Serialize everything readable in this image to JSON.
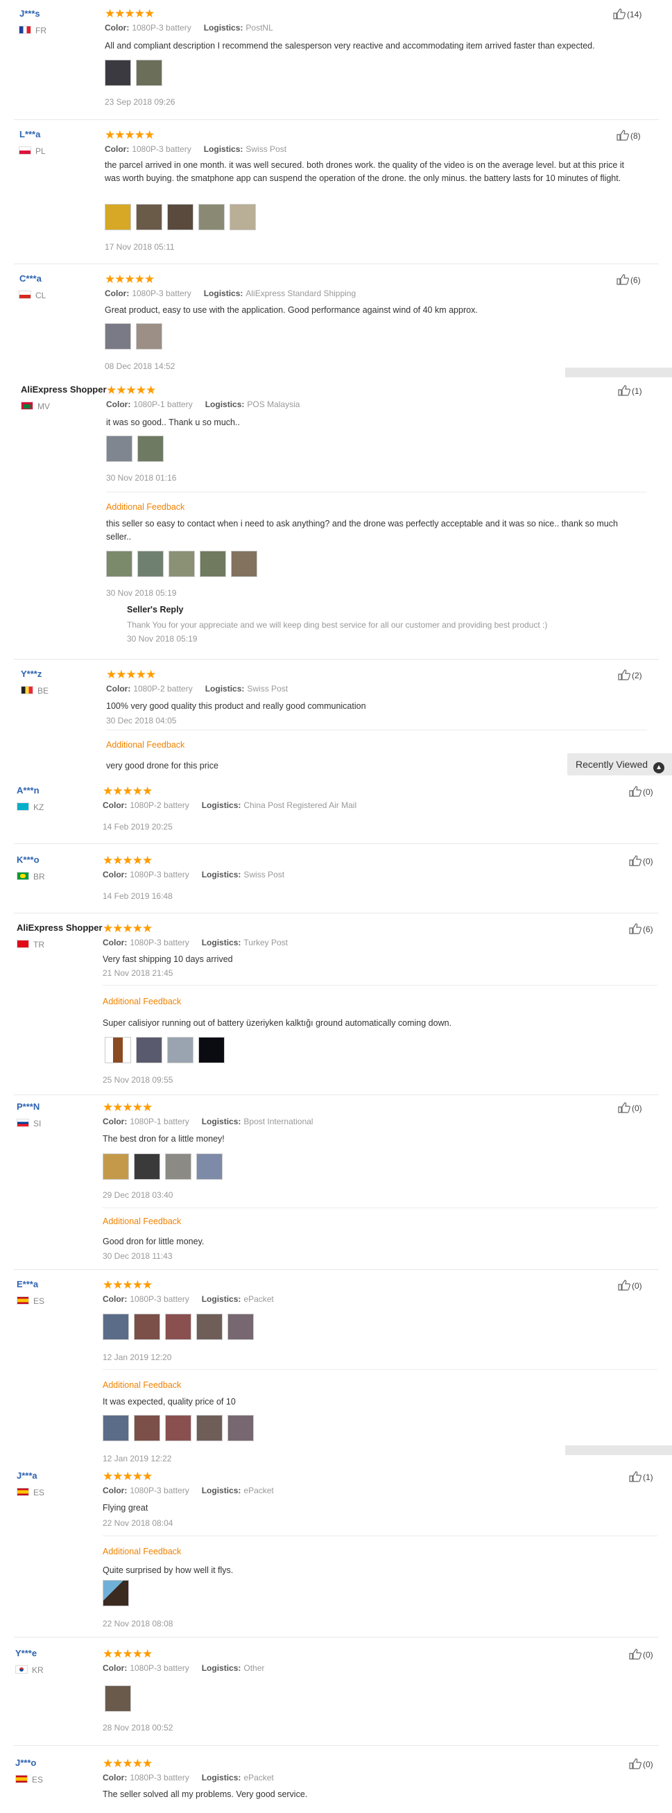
{
  "labels": {
    "color": "Color:",
    "logistics": "Logistics:",
    "additional_feedback": "Additional Feedback",
    "sellers_reply": "Seller's Reply",
    "recently_viewed": "Recently Viewed"
  },
  "colors": {
    "star": "#ff9c00",
    "link": "#2e63b0",
    "feedback": "#f08200"
  },
  "reviews": [
    {
      "user": "J***s",
      "country": "FR",
      "stars": "★★★★★",
      "color": "1080P-3 battery",
      "logistics": "PostNL",
      "text": "All and compliant description I recommend the salesperson very reactive and accommodating item arrived faster than expected.",
      "date": "23 Sep 2018 09:26",
      "helpful": "(14)"
    },
    {
      "user": "L***a",
      "country": "PL",
      "stars": "★★★★★",
      "color": "1080P-3 battery",
      "logistics": "Swiss Post",
      "text": "the parcel arrived in one month. it was well secured. both drones work. the quality of the video is on the average level. but at this price it was worth buying. the smatphone app can suspend the operation of the drone. the only minus. the battery lasts for 10 minutes of flight.",
      "date": "17 Nov 2018 05:11",
      "helpful": "(8)"
    },
    {
      "user": "C***a",
      "country": "CL",
      "stars": "★★★★★",
      "color": "1080P-3 battery",
      "logistics": "AliExpress Standard Shipping",
      "text": "Great product, easy to use with the application. Good performance against wind of 40 km approx.",
      "date": "08 Dec 2018 14:52",
      "helpful": "(6)"
    },
    {
      "user": "AliExpress Shopper",
      "country": "MV",
      "stars": "★★★★★",
      "color": "1080P-1 battery",
      "logistics": "POS Malaysia",
      "text": "it was so good.. Thank u so much..",
      "date": "30 Nov 2018 01:16",
      "helpful": "(1)",
      "fb_text": "this seller so easy to contact when i need to ask anything? and the drone was perfectly acceptable and it was so nice.. thank so much seller..",
      "fb_date": "30 Nov 2018 05:19",
      "reply_text": "Thank You for your appreciate and we will keep ding best service for all our customer and providing best product :)",
      "reply_date": "30 Nov 2018 05:19"
    },
    {
      "user": "Y***z",
      "country": "BE",
      "stars": "★★★★★",
      "color": "1080P-2 battery",
      "logistics": "Swiss Post",
      "text": "100% very good quality this product and really good communication",
      "date": "30 Dec 2018 04:05",
      "helpful": "(2)",
      "fb_text": "very good drone for this price"
    },
    {
      "user": "A***n",
      "country": "KZ",
      "stars": "★★★★★",
      "color": "1080P-2 battery",
      "logistics": "China Post Registered Air Mail",
      "date": "14 Feb 2019 20:25",
      "helpful": "(0)"
    },
    {
      "user": "K***o",
      "country": "BR",
      "stars": "★★★★★",
      "color": "1080P-3 battery",
      "logistics": "Swiss Post",
      "date": "14 Feb 2019 16:48",
      "helpful": "(0)"
    },
    {
      "user": "AliExpress Shopper",
      "country": "TR",
      "stars": "★★★★★",
      "color": "1080P-3 battery",
      "logistics": "Turkey Post",
      "text": "Very fast shipping 10 days arrived",
      "date": "21 Nov 2018 21:45",
      "helpful": "(6)",
      "fb_text": "Super calisiyor running out of battery üzeriyken kalktığı ground automatically coming down.",
      "fb_date": "25 Nov 2018 09:55"
    },
    {
      "user": "P***N",
      "country": "SI",
      "stars": "★★★★★",
      "color": "1080P-1 battery",
      "logistics": "Bpost International",
      "text": "The best dron for a little money!",
      "date": "29 Dec 2018 03:40",
      "helpful": "(0)",
      "fb_text": "Good dron for little money.",
      "fb_date": "30 Dec 2018 11:43"
    },
    {
      "user": "E***a",
      "country": "ES",
      "stars": "★★★★★",
      "color": "1080P-3 battery",
      "logistics": "ePacket",
      "date": "12 Jan 2019 12:20",
      "helpful": "(0)",
      "fb_text": "It was expected, quality price of 10",
      "fb_date": "12 Jan 2019 12:22"
    },
    {
      "user": "J***a",
      "country": "ES",
      "stars": "★★★★★",
      "color": "1080P-3 battery",
      "logistics": "ePacket",
      "text": "Flying great",
      "date": "22 Nov 2018 08:04",
      "helpful": "(1)",
      "fb_text": "Quite surprised by how well it flys.",
      "fb_date": "22 Nov 2018 08:08"
    },
    {
      "user": "Y***e",
      "country": "KR",
      "stars": "★★★★★",
      "color": "1080P-3 battery",
      "logistics": "Other",
      "date": "28 Nov 2018 00:52",
      "helpful": "(0)"
    },
    {
      "user": "J***o",
      "country": "ES",
      "stars": "★★★★★",
      "color": "1080P-3 battery",
      "logistics": "ePacket",
      "text": "The seller solved all my problems. Very good service.",
      "helpful": "(0)"
    }
  ]
}
